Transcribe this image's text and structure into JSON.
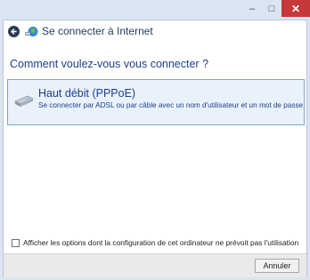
{
  "window": {
    "title": "Se connecter à Internet",
    "minimize_glyph": "‒",
    "maximize_glyph": "□",
    "close_glyph": "✕"
  },
  "prompt": {
    "question": "Comment voulez-vous vous connecter ?"
  },
  "options": [
    {
      "title": "Haut débit (PPPoE)",
      "description": "Se connecter par ADSL ou par câble avec un nom d'utilisateur et un mot de passe",
      "icon": "modem-icon"
    }
  ],
  "checkbox": {
    "label": "Afficher les options dont la configuration de cet ordinateur ne prévoit pas l'utilisation",
    "checked": false
  },
  "footer": {
    "cancel_label": "Annuler"
  },
  "colors": {
    "accent": "#1e3f8a",
    "close_button": "#c7383a",
    "selection_bg": "#e9f1fb",
    "selection_border": "#7da2ce"
  }
}
